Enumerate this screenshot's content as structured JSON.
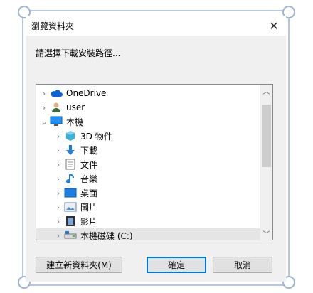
{
  "window": {
    "title": "瀏覽資料夾"
  },
  "dialog": {
    "prompt": "請選擇下載安裝路徑..."
  },
  "tree": {
    "items": [
      {
        "label": "OneDrive",
        "icon": "cloud-icon",
        "chev": "right"
      },
      {
        "label": "user",
        "icon": "user-icon",
        "chev": "right"
      },
      {
        "label": "本機",
        "icon": "computer-icon",
        "chev": "down"
      },
      {
        "label": "3D 物件",
        "icon": "3d-objects-icon",
        "chev": "right"
      },
      {
        "label": "下載",
        "icon": "download-icon",
        "chev": "right"
      },
      {
        "label": "文件",
        "icon": "document-icon",
        "chev": "right"
      },
      {
        "label": "音樂",
        "icon": "music-icon",
        "chev": "right"
      },
      {
        "label": "桌面",
        "icon": "desktop-icon",
        "chev": "right"
      },
      {
        "label": "圖片",
        "icon": "pictures-icon",
        "chev": "right"
      },
      {
        "label": "影片",
        "icon": "videos-icon",
        "chev": "right"
      },
      {
        "label": "本機磁碟 (C:)",
        "icon": "drive-icon",
        "chev": "right",
        "selected": true
      }
    ]
  },
  "buttons": {
    "new_folder": "建立新資料夾(M)",
    "ok": "確定",
    "cancel": "取消"
  },
  "colors": {
    "accent": "#0078d7",
    "frame": "#b9c7dc"
  }
}
